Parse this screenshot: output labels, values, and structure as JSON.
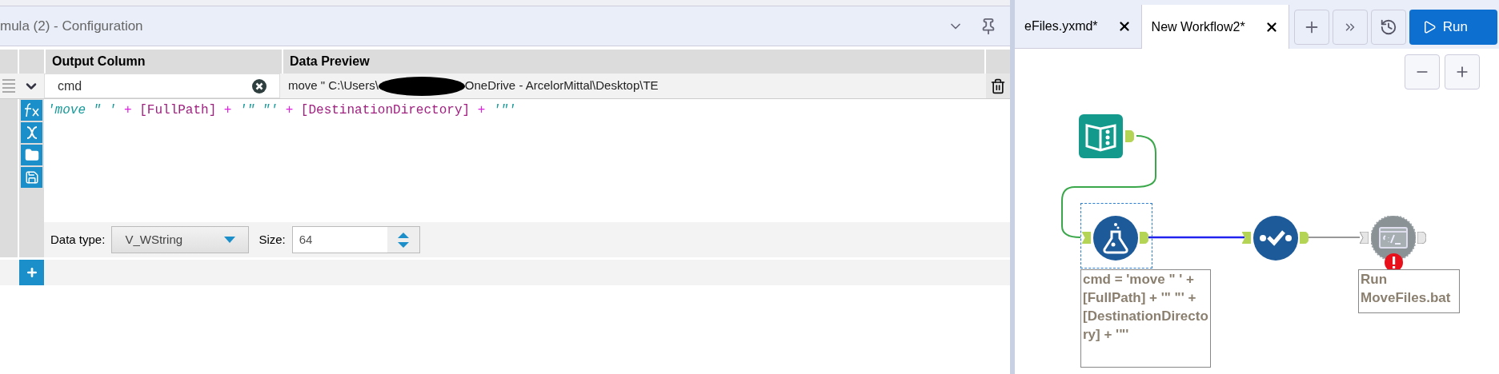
{
  "config_panel": {
    "title": "mula (2) - Configuration"
  },
  "table": {
    "columns": [
      "Output Column",
      "Data Preview"
    ],
    "rows": [
      {
        "expanded": true,
        "output_column": "cmd",
        "preview_start": "move \" C:\\Users\\",
        "preview_end": "OneDrive - ArcelorMittal\\Desktop\\TE",
        "expression": [
          {
            "kind": "string",
            "text": "'move \" '"
          },
          {
            "kind": "operator",
            "text": "+"
          },
          {
            "kind": "field",
            "text": "[FullPath]"
          },
          {
            "kind": "operator",
            "text": "+"
          },
          {
            "kind": "string",
            "text": "'\" \"'"
          },
          {
            "kind": "operator",
            "text": "+"
          },
          {
            "kind": "field",
            "text": "[DestinationDirectory]"
          },
          {
            "kind": "operator",
            "text": "+"
          },
          {
            "kind": "string",
            "text": "'\"'"
          }
        ],
        "data_type_label": "Data type:",
        "data_type": "V_WString",
        "size_label": "Size:",
        "size": "64"
      }
    ]
  },
  "tabs": [
    {
      "label": "eFiles.yxmd*",
      "selected": false
    },
    {
      "label": "New Workflow2*",
      "selected": true
    }
  ],
  "run_button": "Run",
  "canvas": {
    "nodes": [
      {
        "kind": "input",
        "selected": false,
        "error": false
      },
      {
        "kind": "formula",
        "selected": true,
        "error": false
      },
      {
        "kind": "check",
        "selected": false,
        "error": false
      },
      {
        "kind": "command",
        "selected": false,
        "error": true
      }
    ],
    "annotations": [
      {
        "text": "cmd = 'move \" ' + [FullPath] + '\" \"' + [DestinationDirectory] + '\"'"
      },
      {
        "text": "Run MoveFiles.bat"
      }
    ]
  }
}
